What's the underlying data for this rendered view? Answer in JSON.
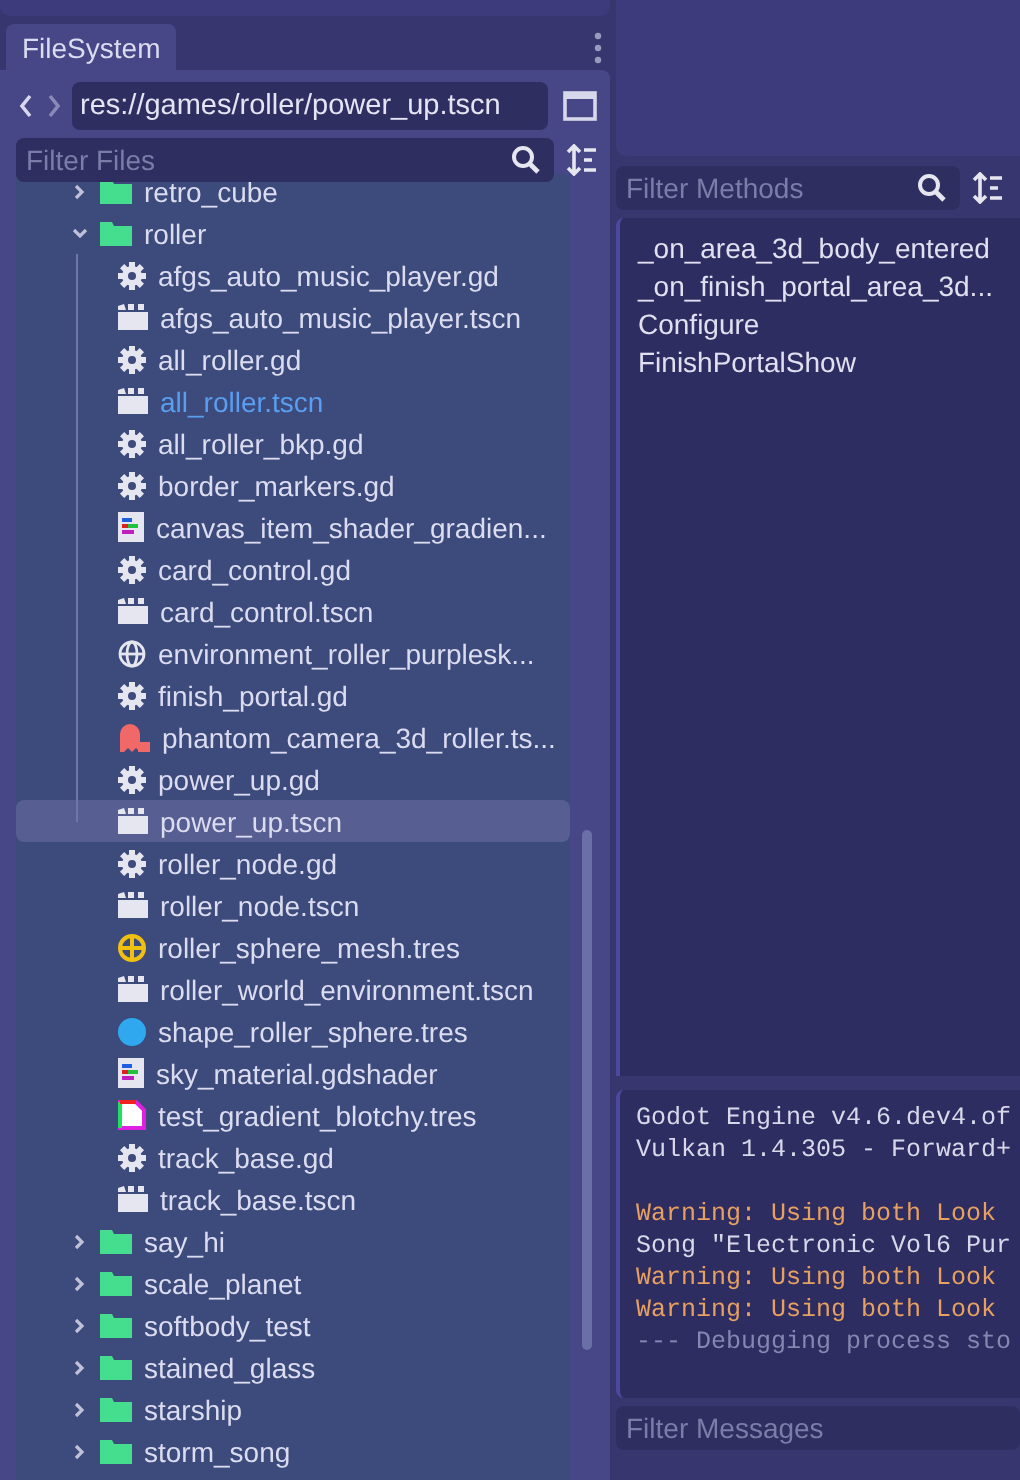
{
  "filesystem": {
    "tab": "FileSystem",
    "path": "res://games/roller/power_up.tscn",
    "filter": {
      "placeholder": "Filter Files"
    },
    "tree": [
      {
        "name": "retro_cube",
        "kind": "folder",
        "expanded": false,
        "selected": false,
        "current": false
      },
      {
        "name": "roller",
        "kind": "folder",
        "expanded": true,
        "selected": false,
        "current": false,
        "children": [
          {
            "name": "afgs_auto_music_player.gd",
            "kind": "script",
            "selected": false,
            "current": false
          },
          {
            "name": "afgs_auto_music_player.tscn",
            "kind": "scene",
            "selected": false,
            "current": false
          },
          {
            "name": "all_roller.gd",
            "kind": "script",
            "selected": false,
            "current": false
          },
          {
            "name": "all_roller.tscn",
            "kind": "scene",
            "selected": false,
            "current": true
          },
          {
            "name": "all_roller_bkp.gd",
            "kind": "script",
            "selected": false,
            "current": false
          },
          {
            "name": "border_markers.gd",
            "kind": "script",
            "selected": false,
            "current": false
          },
          {
            "name": "canvas_item_shader_gradien...",
            "kind": "shader",
            "selected": false,
            "current": false
          },
          {
            "name": "card_control.gd",
            "kind": "script",
            "selected": false,
            "current": false
          },
          {
            "name": "card_control.tscn",
            "kind": "scene",
            "selected": false,
            "current": false
          },
          {
            "name": "environment_roller_purplesk...",
            "kind": "environment",
            "selected": false,
            "current": false
          },
          {
            "name": "finish_portal.gd",
            "kind": "script",
            "selected": false,
            "current": false
          },
          {
            "name": "phantom_camera_3d_roller.ts...",
            "kind": "phantom",
            "selected": false,
            "current": false
          },
          {
            "name": "power_up.gd",
            "kind": "script",
            "selected": false,
            "current": false
          },
          {
            "name": "power_up.tscn",
            "kind": "scene",
            "selected": true,
            "current": false
          },
          {
            "name": "roller_node.gd",
            "kind": "script",
            "selected": false,
            "current": false
          },
          {
            "name": "roller_node.tscn",
            "kind": "scene",
            "selected": false,
            "current": false
          },
          {
            "name": "roller_sphere_mesh.tres",
            "kind": "mesh",
            "selected": false,
            "current": false
          },
          {
            "name": "roller_world_environment.tscn",
            "kind": "scene",
            "selected": false,
            "current": false
          },
          {
            "name": "shape_roller_sphere.tres",
            "kind": "sphere",
            "selected": false,
            "current": false
          },
          {
            "name": "sky_material.gdshader",
            "kind": "shader",
            "selected": false,
            "current": false
          },
          {
            "name": "test_gradient_blotchy.tres",
            "kind": "gradient",
            "selected": false,
            "current": false
          },
          {
            "name": "track_base.gd",
            "kind": "script",
            "selected": false,
            "current": false
          },
          {
            "name": "track_base.tscn",
            "kind": "scene",
            "selected": false,
            "current": false
          }
        ]
      },
      {
        "name": "say_hi",
        "kind": "folder",
        "expanded": false,
        "selected": false,
        "current": false
      },
      {
        "name": "scale_planet",
        "kind": "folder",
        "expanded": false,
        "selected": false,
        "current": false
      },
      {
        "name": "softbody_test",
        "kind": "folder",
        "expanded": false,
        "selected": false,
        "current": false
      },
      {
        "name": "stained_glass",
        "kind": "folder",
        "expanded": false,
        "selected": false,
        "current": false
      },
      {
        "name": "starship",
        "kind": "folder",
        "expanded": false,
        "selected": false,
        "current": false
      },
      {
        "name": "storm_song",
        "kind": "folder",
        "expanded": false,
        "selected": false,
        "current": false
      }
    ]
  },
  "methods": {
    "filter": {
      "placeholder": "Filter Methods"
    },
    "items": [
      "_on_area_3d_body_entered",
      "_on_finish_portal_area_3d...",
      "Configure",
      "FinishPortalShow"
    ]
  },
  "output": {
    "lines": [
      {
        "text": "Godot Engine v4.6.dev4.of",
        "kind": "info"
      },
      {
        "text": "Vulkan 1.4.305 - Forward+",
        "kind": "info"
      },
      {
        "kind": "blank"
      },
      {
        "text": "Warning: Using both Look",
        "kind": "warning"
      },
      {
        "text": "Song \"Electronic Vol6 Pur",
        "kind": "info"
      },
      {
        "text": "Warning: Using both Look",
        "kind": "warning"
      },
      {
        "text": "Warning: Using both Look",
        "kind": "warning"
      },
      {
        "text": "--- Debugging process sto",
        "kind": "debug"
      }
    ],
    "filter": {
      "placeholder": "Filter Messages"
    }
  }
}
